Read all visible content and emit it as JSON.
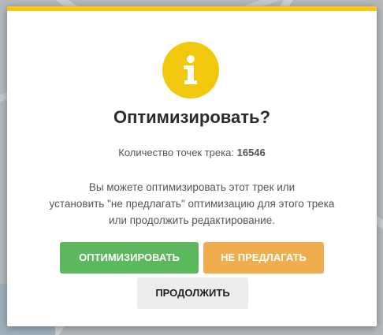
{
  "colors": {
    "accent_top": "#f6c90e",
    "info_icon_bg": "#f2c80f",
    "optimize_button": "#5cb85c",
    "dont_offer_button": "#f0ad4e",
    "continue_button": "#eaeced"
  },
  "dialog": {
    "icon": "info-icon",
    "title": "Оптимизировать?",
    "count_label": "Количество точек трека:",
    "count_value": "16546",
    "description_lines": [
      "Вы можете оптимизировать этот трек или",
      "установить \"не предлагать\" оптимизацию для этого трека",
      "или продолжить редактирование."
    ],
    "buttons": {
      "optimize": "ОПТИМИЗИРОВАТЬ",
      "dont_offer": "НЕ ПРЕДЛАГАТЬ",
      "continue": "ПРОДОЛЖИТЬ"
    }
  }
}
